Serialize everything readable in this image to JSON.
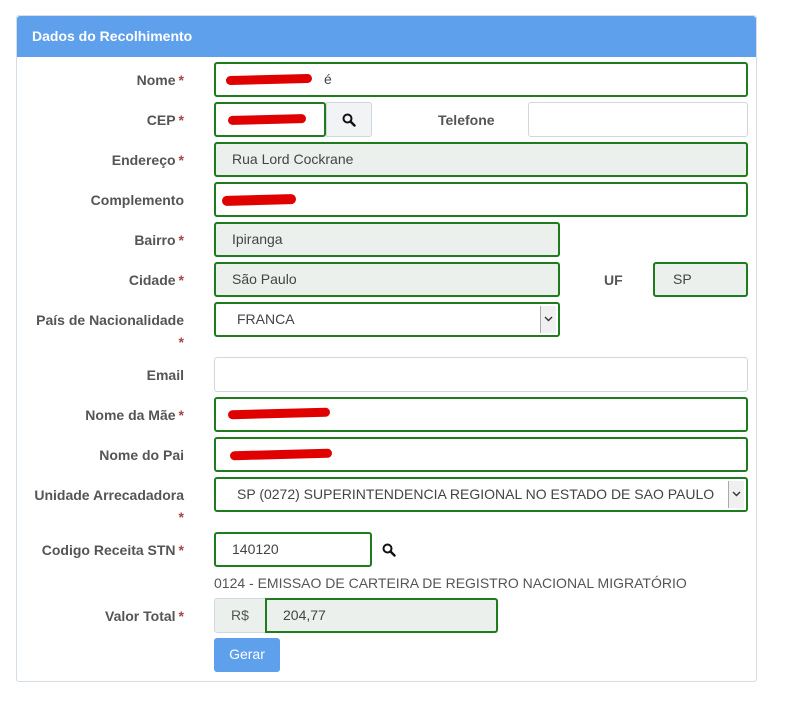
{
  "panel": {
    "title": "Dados do Recolhimento"
  },
  "required_mark": "*",
  "labels": {
    "nome": "Nome",
    "cep": "CEP",
    "telefone": "Telefone",
    "endereco": "Endereço",
    "complemento": "Complemento",
    "bairro": "Bairro",
    "cidade": "Cidade",
    "uf": "UF",
    "pais_line1": "País de Nacionalidade",
    "email": "Email",
    "nome_mae": "Nome da Mãe",
    "nome_pai": "Nome do Pai",
    "unidade_line1": "Unidade Arrecadadora",
    "codigo_receita": "Codigo Receita STN",
    "valor_total": "Valor Total"
  },
  "values": {
    "nome": "é",
    "endereco": "Rua Lord Cockrane",
    "bairro": "Ipiranga",
    "cidade": "São Paulo",
    "uf": "SP",
    "pais": "FRANCA",
    "unidade": "SP (0272) SUPERINTENDENCIA REGIONAL NO ESTADO DE SAO PAULO",
    "codigo_receita": "140120",
    "codigo_receita_desc": "0124 - EMISSAO DE CARTEIRA DE REGISTRO NACIONAL MIGRATÓRIO",
    "valor_prefix": "R$",
    "valor_total": "204,77"
  },
  "buttons": {
    "gerar": "Gerar"
  },
  "icons": {
    "search": "search-icon",
    "select": "chevron-down-icon"
  },
  "colors": {
    "header": "#5ea0ec",
    "valid_border": "#1e7b1e",
    "readonly_bg": "#ebf0ed",
    "redaction": "#e00000"
  }
}
